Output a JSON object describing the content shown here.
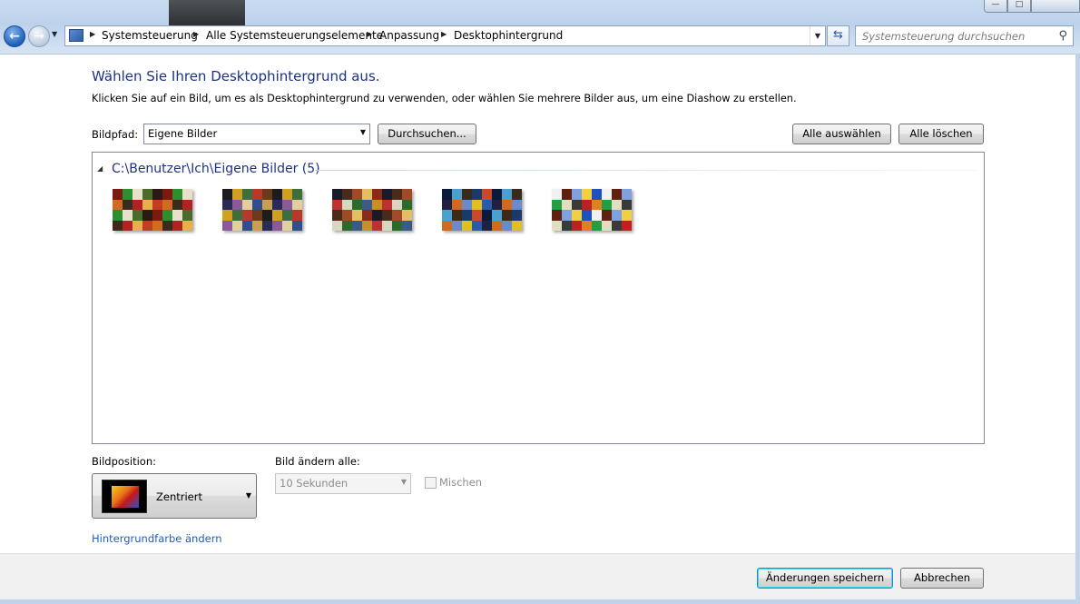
{
  "address_bar": {
    "breadcrumbs": [
      "Systemsteuerung",
      "Alle Systemsteuerungselemente",
      "Anpassung",
      "Desktophintergrund"
    ]
  },
  "search": {
    "placeholder": "Systemsteuerung durchsuchen"
  },
  "main": {
    "heading": "Wählen Sie Ihren Desktophintergrund aus.",
    "description": "Klicken Sie auf ein Bild, um es als Desktophintergrund zu verwenden, oder wählen Sie mehrere Bilder aus, um eine Diashow zu erstellen.",
    "path_label": "Bildpfad:",
    "path_value": "Eigene Bilder",
    "browse_button": "Durchsuchen...",
    "select_all_button": "Alle auswählen",
    "clear_all_button": "Alle löschen"
  },
  "gallery": {
    "group_title": "C:\\Benutzer\\Ich\\Eigene Bilder (5)",
    "image_count": 5
  },
  "options": {
    "position_label": "Bildposition:",
    "position_value": "Zentriert",
    "interval_label": "Bild ändern alle:",
    "interval_value": "10 Sekunden",
    "shuffle_label": "Mischen",
    "shuffle_checked": false,
    "background_color_link": "Hintergrundfarbe ändern"
  },
  "footer": {
    "save_button": "Änderungen speichern",
    "cancel_button": "Abbrechen"
  },
  "colors": {
    "heading": "#1e3287",
    "link": "#1e5fb8",
    "glass": "#bcd2ec"
  }
}
